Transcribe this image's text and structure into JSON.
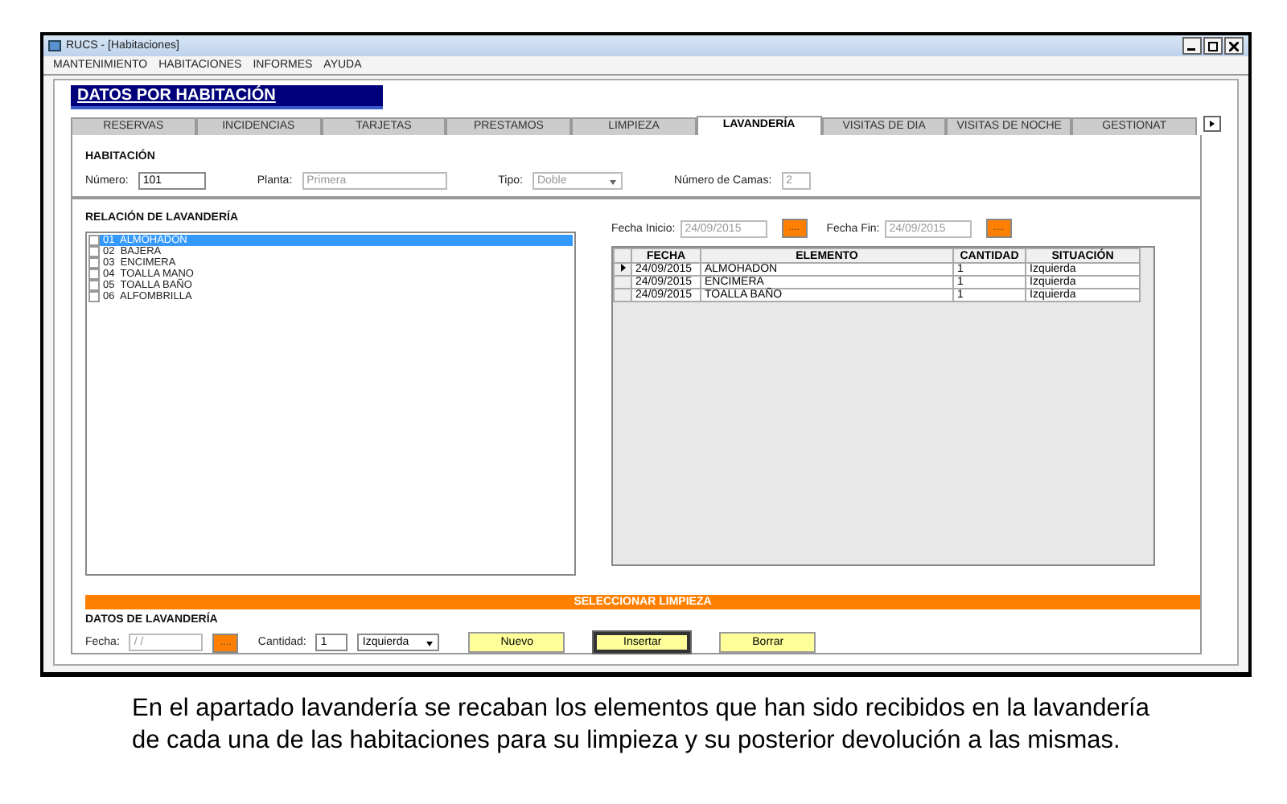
{
  "window": {
    "title": "RUCS - [Habitaciones]"
  },
  "menu": [
    "MANTENIMIENTO",
    "HABITACIONES",
    "INFORMES",
    "AYUDA"
  ],
  "header": "DATOS POR HABITACIÓN",
  "tabs": [
    {
      "label": "RESERVAS",
      "selected": false
    },
    {
      "label": "INCIDENCIAS",
      "selected": false
    },
    {
      "label": "TARJETAS",
      "selected": false
    },
    {
      "label": "PRESTAMOS",
      "selected": false
    },
    {
      "label": "LIMPIEZA",
      "selected": false
    },
    {
      "label": "LAVANDERÍA",
      "selected": true
    },
    {
      "label": "VISITAS DE DIA",
      "selected": false
    },
    {
      "label": "VISITAS DE NOCHE",
      "selected": false
    },
    {
      "label": "GESTIONAT",
      "selected": false
    }
  ],
  "habitacion": {
    "title": "HABITACIÓN",
    "fields": [
      {
        "kind": "text",
        "label": "Número:",
        "value": "101",
        "disabled": false
      },
      {
        "kind": "text",
        "label": "Planta:",
        "value": "Primera",
        "disabled": true
      },
      {
        "kind": "select",
        "label": "Tipo:",
        "value": "Doble",
        "disabled": true
      },
      {
        "kind": "text",
        "label": "Número de Camas:",
        "value": "2",
        "disabled": true
      }
    ]
  },
  "relacion": {
    "title": "RELACIÓN DE LAVANDERÍA",
    "items": [
      {
        "label": "01  ALMOHADON",
        "checked": false,
        "selected": true
      },
      {
        "label": "02  BAJERA",
        "checked": false,
        "selected": false
      },
      {
        "label": "03  ENCIMERA",
        "checked": false,
        "selected": false
      },
      {
        "label": "04  TOALLA MANO",
        "checked": false,
        "selected": false
      },
      {
        "label": "05  TOALLA BAÑO",
        "checked": false,
        "selected": false
      },
      {
        "label": "06  ALFOMBRILLA",
        "checked": false,
        "selected": false
      }
    ]
  },
  "dates": [
    {
      "label": "Fecha Inicio:",
      "value": "24/09/2015",
      "button": "...."
    },
    {
      "label": "Fecha Fin:",
      "value": "24/09/2015",
      "button": "...."
    }
  ],
  "grid": {
    "columns": [
      "FECHA",
      "ELEMENTO",
      "CANTIDAD",
      "SITUACIÓN"
    ],
    "rows": [
      {
        "current": true,
        "cells": [
          "24/09/2015",
          "ALMOHADON",
          "1",
          "Izquierda"
        ]
      },
      {
        "current": false,
        "cells": [
          "24/09/2015",
          "ENCIMERA",
          "1",
          "Izquierda"
        ]
      },
      {
        "current": false,
        "cells": [
          "24/09/2015",
          "TOALLA BAÑO",
          "1",
          "Izquierda"
        ]
      }
    ]
  },
  "select_bar": "SELECCIONAR LIMPIEZA",
  "datos": {
    "title": "DATOS DE LAVANDERÍA",
    "fecha_label": "Fecha:",
    "fecha_value": "/ /",
    "fecha_button": "....",
    "cantidad_label": "Cantidad:",
    "cantidad_value": "1",
    "situacion": "Izquierda",
    "buttons": [
      {
        "label": "Nuevo",
        "focused": false
      },
      {
        "label": "Insertar",
        "focused": true
      },
      {
        "label": "Borrar",
        "focused": false
      }
    ]
  },
  "caption": "En el apartado lavandería se recaban los elementos que han sido recibidos en la lavandería de cada una de las habitaciones para su limpieza y su posterior devolución a las mismas."
}
